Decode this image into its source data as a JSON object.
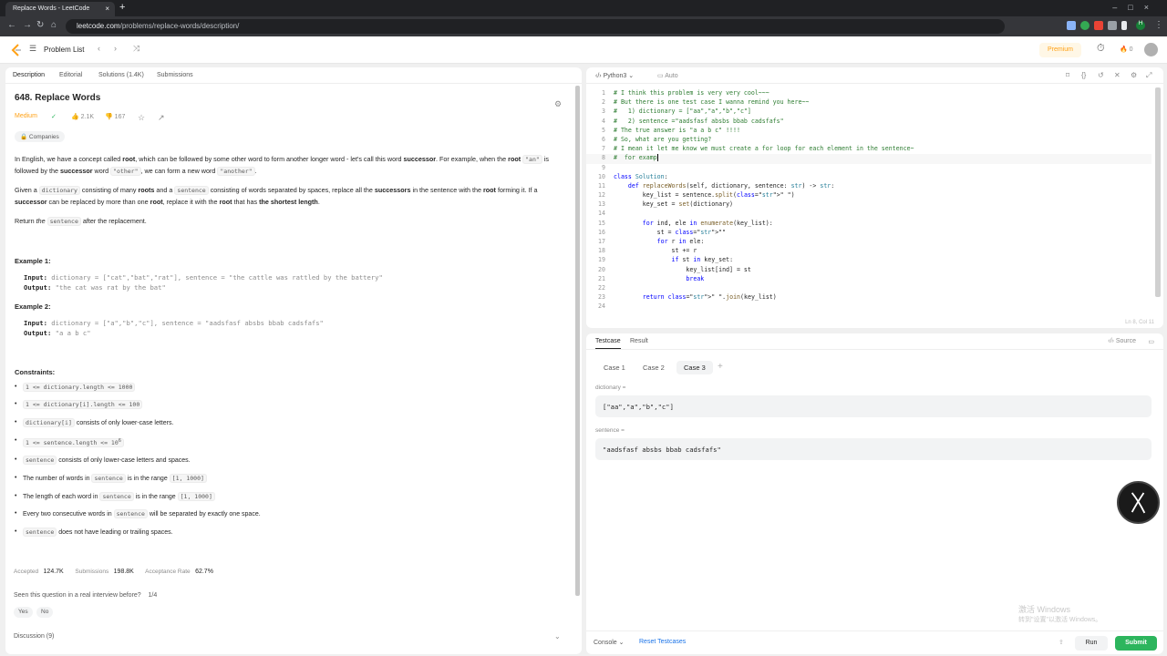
{
  "browser": {
    "tab_title": "Replace Words - LeetCode",
    "url_host": "leetcode.com",
    "url_path": "/problems/replace-words/description/"
  },
  "nav": {
    "problem_list": "Problem List",
    "premium": "Premium",
    "streak_count": "0"
  },
  "left_tabs": [
    "Description",
    "Editorial",
    "Solutions (1.4K)",
    "Submissions"
  ],
  "problem": {
    "title": "648. Replace Words",
    "difficulty": "Medium",
    "likes": "2.1K",
    "dislikes": "167",
    "companies": "Companies",
    "p1_a": "In English, we have a concept called ",
    "p1_root": "root",
    "p1_b": ", which can be followed by some other word to form another longer word - let's call this word ",
    "p1_successor": "successor",
    "p1_c": ". For example, when the ",
    "p1_root2": "root",
    "p1_code1": "\"an\"",
    "p1_d": " is followed by the ",
    "p1_successor2": "successor",
    "p1_e": " word ",
    "p1_code2": "\"other\"",
    "p1_f": ", we can form a new word ",
    "p1_code3": "\"another\"",
    "p1_g": ".",
    "p2_a": "Given a ",
    "p2_code1": "dictionary",
    "p2_b": " consisting of many ",
    "p2_roots": "roots",
    "p2_c": " and a ",
    "p2_code2": "sentence",
    "p2_d": " consisting of words separated by spaces, replace all the ",
    "p2_successors": "successors",
    "p2_e": " in the sentence with the ",
    "p2_root": "root",
    "p2_f": " forming it. If a ",
    "p2_successor": "successor",
    "p2_g": " can be replaced by more than one ",
    "p2_root2": "root",
    "p2_h": ", replace it with the ",
    "p2_root3": "root",
    "p2_i": " that has ",
    "p2_shortest": "the shortest length",
    "p2_j": ".",
    "p3_a": "Return ",
    "p3_the": "the",
    "p3_code": "sentence",
    "p3_b": " after the replacement."
  },
  "examples": [
    {
      "heading": "Example 1:",
      "input_label": "Input:",
      "input": "dictionary = [\"cat\",\"bat\",\"rat\"], sentence = \"the cattle was rattled by the battery\"",
      "output_label": "Output:",
      "output": "\"the cat was rat by the bat\""
    },
    {
      "heading": "Example 2:",
      "input_label": "Input:",
      "input": "dictionary = [\"a\",\"b\",\"c\"], sentence = \"aadsfasf absbs bbab cadsfafs\"",
      "output_label": "Output:",
      "output": "\"a a b c\""
    }
  ],
  "constraints": {
    "heading": "Constraints:",
    "c1": "1 <= dictionary.length <= 1000",
    "c2": "1 <= dictionary[i].length <= 100",
    "c3_code": "dictionary[i]",
    "c3_text": " consists of only lower-case letters.",
    "c4": "1 <= sentence.length <= 10",
    "c4_sup": "6",
    "c5_code": "sentence",
    "c5_text": " consists of only lower-case letters and spaces.",
    "c6_a": "The number of words in ",
    "c6_code": "sentence",
    "c6_b": " is in the range ",
    "c6_range": "[1, 1000]",
    "c7_a": "The length of each word in ",
    "c7_code": "sentence",
    "c7_b": " is in the range ",
    "c7_range": "[1, 1000]",
    "c8_a": "Every two consecutive words in ",
    "c8_code": "sentence",
    "c8_b": " will be separated by exactly one space.",
    "c9_code": "sentence",
    "c9_text": " does not have leading or trailing spaces."
  },
  "stats": {
    "accepted_label": "Accepted",
    "accepted": "124.7K",
    "submissions_label": "Submissions",
    "submissions": "198.8K",
    "rate_label": "Acceptance Rate",
    "rate": "62.7%"
  },
  "seen": {
    "question": "Seen this question in a real interview before?",
    "count": "1/4",
    "yes": "Yes",
    "no": "No"
  },
  "discussion": "Discussion (9)",
  "editor": {
    "language": "Python3",
    "mode": "Auto",
    "cursor_pos": "Ln 8, Col 11",
    "lines": [
      "# I think this problem is very very cool~~~",
      "# But there is one test case I wanna remind you here~~",
      "#   1) dictionary = [\"aa\",\"a\",\"b\",\"c\"]",
      "#   2) sentence =\"aadsfasf absbs bbab cadsfafs\"",
      "# The true answer is \"a a b c\" !!!!",
      "# So, what are you getting?",
      "# I mean it let me know we must create a for loop for each element in the sentence~",
      "#  for examp",
      "",
      "class Solution:",
      "    def replaceWords(self, dictionary, sentence: str) -> str:",
      "        key_list = sentence.split(\" \")",
      "        key_set = set(dictionary)",
      "",
      "        for ind, ele in enumerate(key_list):",
      "            st = \"\"",
      "            for r in ele:",
      "                st += r",
      "                if st in key_set:",
      "                    key_list[ind] = st",
      "                    break",
      "",
      "        return \" \".join(key_list)",
      ""
    ]
  },
  "testcase": {
    "tab_testcase": "Testcase",
    "tab_result": "Result",
    "source": "Source",
    "cases": [
      "Case 1",
      "Case 2",
      "Case 3"
    ],
    "dict_label": "dictionary =",
    "dict_value": "[\"aa\",\"a\",\"b\",\"c\"]",
    "sent_label": "sentence =",
    "sent_value": "\"aadsfasf absbs bbab cadsfafs\""
  },
  "bottom": {
    "console": "Console",
    "reset": "Reset Testcases",
    "run": "Run",
    "submit": "Submit"
  },
  "watermark": {
    "line1": "激活 Windows",
    "line2": "转到\"设置\"以激活 Windows。"
  }
}
